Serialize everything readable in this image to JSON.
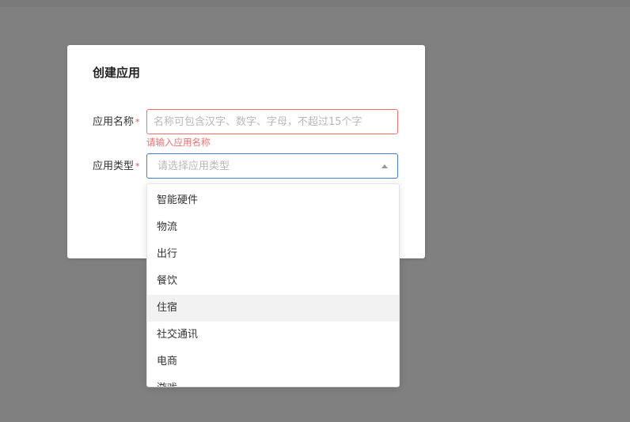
{
  "dialog": {
    "title": "创建应用",
    "name_field": {
      "label": "应用名称",
      "required_mark": "*",
      "placeholder": "名称可包含汉字、数字、字母，不超过15个字",
      "error": "请输入应用名称"
    },
    "type_field": {
      "label": "应用类型",
      "required_mark": "*",
      "placeholder": "请选择应用类型"
    }
  },
  "dropdown": {
    "options": [
      "智能硬件",
      "物流",
      "出行",
      "餐饮",
      "住宿",
      "社交通讯",
      "电商",
      "游戏"
    ],
    "hovered_option": "住宿"
  },
  "colors": {
    "overlay": "#808080",
    "error": "#f56c6c",
    "focus": "#4a7fd6",
    "hover": "#f2f2f2"
  }
}
